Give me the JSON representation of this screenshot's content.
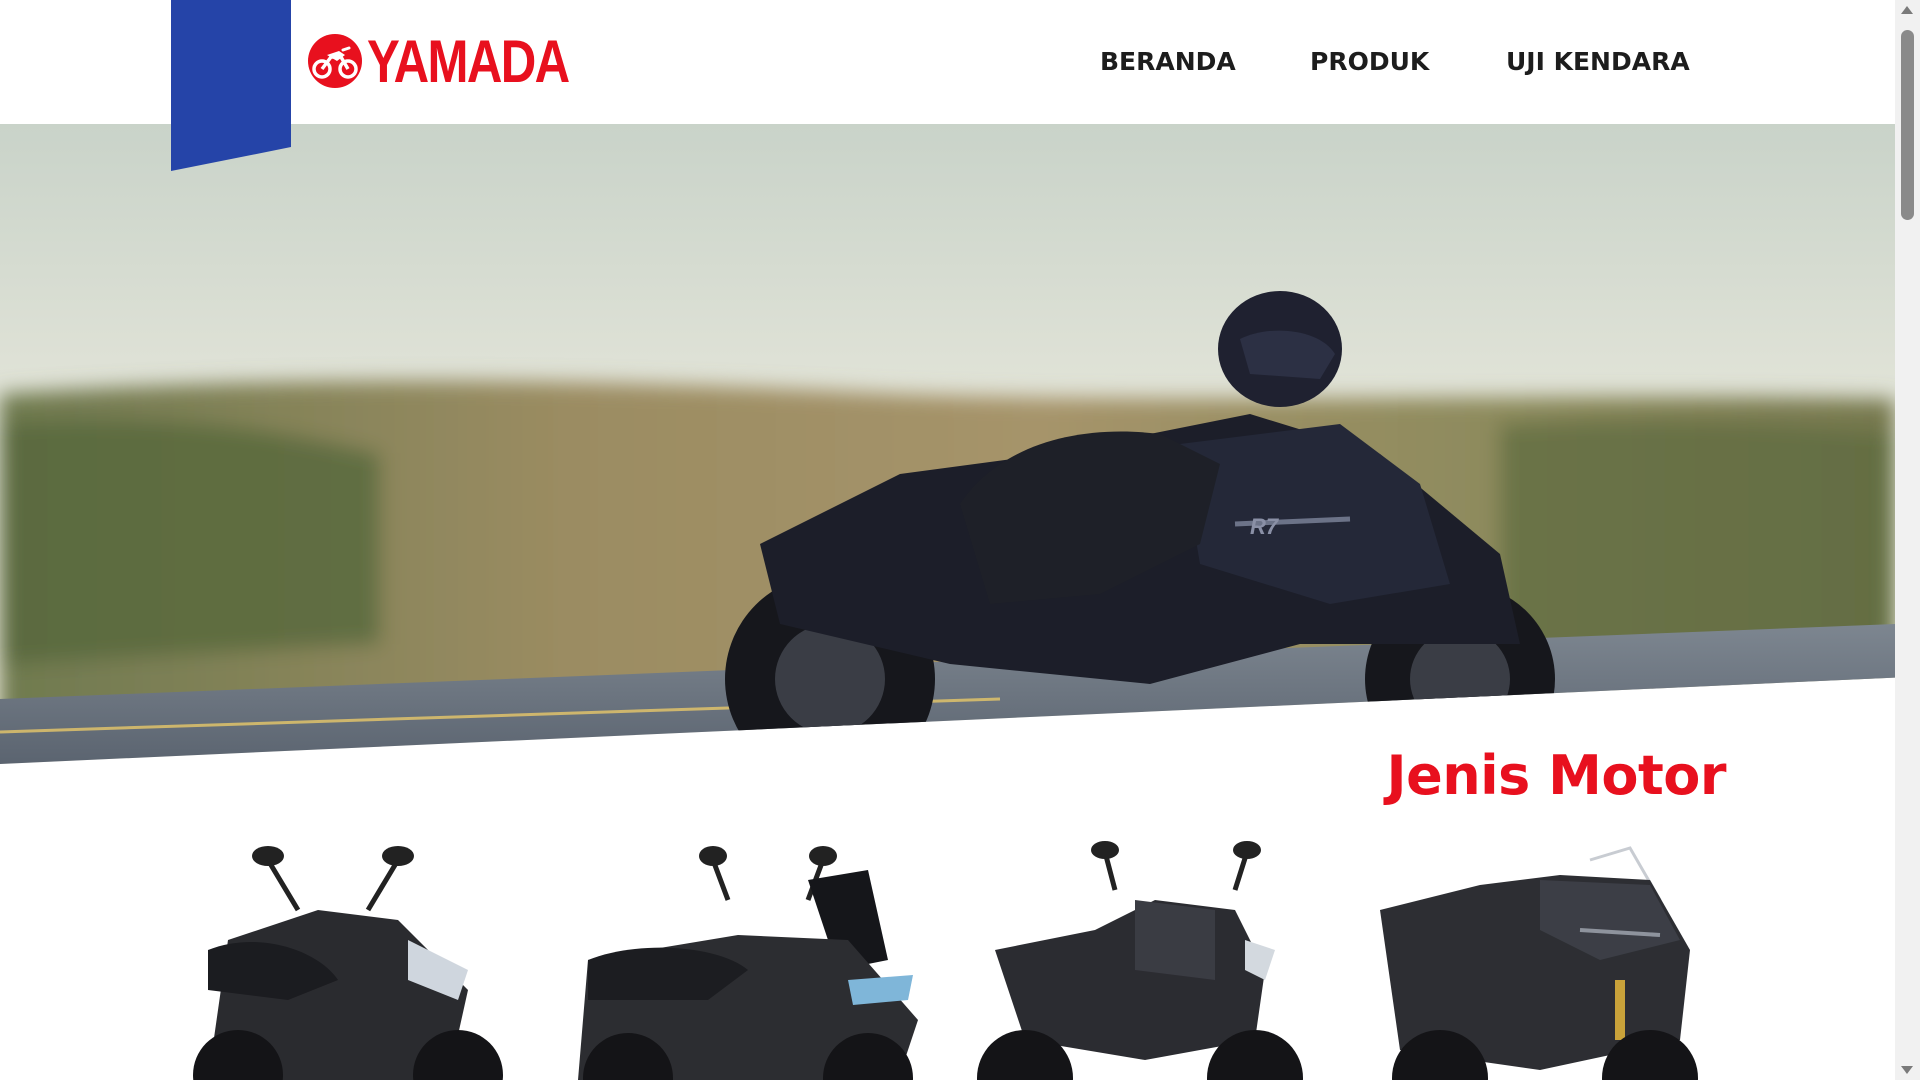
{
  "brand": {
    "name": "YAMADA",
    "logo_icon": "motorcycle-badge-icon",
    "color": "#e8101e",
    "ribbon_color": "#2544a8"
  },
  "nav": {
    "items": [
      {
        "label": "BERANDA"
      },
      {
        "label": "PRODUK"
      },
      {
        "label": "UJI KENDARA"
      }
    ]
  },
  "hero": {
    "image": "rider-on-black-sport-motorcycle-photo",
    "bike_badge": "R7"
  },
  "section": {
    "title": "Jenis Motor",
    "products": [
      {
        "image": "black-scooter-1"
      },
      {
        "image": "black-maxi-scooter"
      },
      {
        "image": "black-naked-sport-bike"
      },
      {
        "image": "black-full-fairing-sport-bike"
      }
    ]
  },
  "scrollbar": {
    "position_fraction": 0.0
  }
}
